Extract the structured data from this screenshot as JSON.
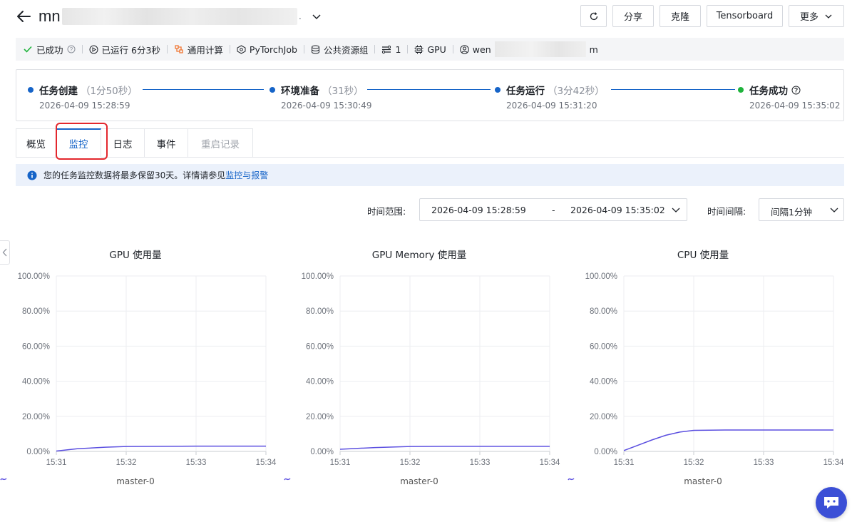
{
  "header": {
    "title_visible": "mn",
    "title_suffix_visible": ".",
    "buttons": {
      "refresh_icon": "refresh-icon",
      "share": "分享",
      "clone": "克隆",
      "tensorboard": "Tensorboard",
      "more": "更多"
    }
  },
  "meta": {
    "status": "已成功",
    "runtime": "已运行 6分3秒",
    "compute_type": "通用计算",
    "framework": "PyTorchJob",
    "resource_group": "公共资源组",
    "replicas": "1",
    "device": "GPU",
    "user_prefix": "wen",
    "user_suffix": "m"
  },
  "timeline": [
    {
      "title": "任务创建",
      "duration": "（1分50秒）",
      "time": "2026-04-09 15:28:59",
      "color": "#1664c8"
    },
    {
      "title": "环境准备",
      "duration": "（31秒）",
      "time": "2026-04-09 15:30:49",
      "color": "#1664c8"
    },
    {
      "title": "任务运行",
      "duration": "（3分42秒）",
      "time": "2026-04-09 15:31:20",
      "color": "#1664c8"
    },
    {
      "title": "任务成功",
      "duration": "",
      "time": "2026-04-09 15:35:02",
      "color": "#1fb33c"
    }
  ],
  "tabs": [
    "概览",
    "监控",
    "日志",
    "事件",
    "重启记录"
  ],
  "banner": {
    "text": "您的任务监控数据将最多保留30天。详情请参见",
    "link": "监控与报警"
  },
  "filters": {
    "range_label": "时间范围:",
    "range_start": "2026-04-09 15:28:59",
    "range_sep": "-",
    "range_end": "2026-04-09 15:35:02",
    "interval_label": "时间间隔:",
    "interval_value": "间隔1分钟"
  },
  "accent_color": "#1664c8",
  "chart_data": [
    {
      "type": "line",
      "title": "GPU 使用量",
      "x": [
        "15:31",
        "15:32",
        "15:33",
        "15:34"
      ],
      "yticks": [
        "0.00%",
        "20.00%",
        "40.00%",
        "60.00%",
        "80.00%",
        "100.00%"
      ],
      "ylim": [
        0,
        100
      ],
      "series": [
        {
          "name": "master-0",
          "points": [
            [
              0,
              0.2
            ],
            [
              0.3,
              1.5
            ],
            [
              0.7,
              2.4
            ],
            [
              1,
              2.8
            ],
            [
              1.5,
              2.9
            ],
            [
              2,
              3.0
            ],
            [
              2.5,
              3.0
            ],
            [
              3,
              3.0
            ]
          ]
        }
      ]
    },
    {
      "type": "line",
      "title": "GPU Memory 使用量",
      "x": [
        "15:31",
        "15:32",
        "15:33",
        "15:34"
      ],
      "yticks": [
        "0.00%",
        "20.00%",
        "40.00%",
        "60.00%",
        "80.00%",
        "100.00%"
      ],
      "ylim": [
        0,
        100
      ],
      "series": [
        {
          "name": "master-0",
          "points": [
            [
              0,
              1.2
            ],
            [
              0.5,
              2.2
            ],
            [
              1,
              2.8
            ],
            [
              1.5,
              2.9
            ],
            [
              2,
              2.9
            ],
            [
              2.5,
              2.9
            ],
            [
              3,
              2.9
            ]
          ]
        }
      ]
    },
    {
      "type": "line",
      "title": "CPU 使用量",
      "x": [
        "15:31",
        "15:32",
        "15:33",
        "15:34"
      ],
      "yticks": [
        "0.00%",
        "20.00%",
        "40.00%",
        "60.00%",
        "80.00%",
        "100.00%"
      ],
      "ylim": [
        0,
        100
      ],
      "series": [
        {
          "name": "master-0",
          "points": [
            [
              0,
              0.5
            ],
            [
              0.2,
              3.5
            ],
            [
              0.4,
              6.5
            ],
            [
              0.6,
              9.2
            ],
            [
              0.8,
              11.0
            ],
            [
              1,
              12.0
            ],
            [
              1.5,
              12.2
            ],
            [
              2,
              12.2
            ],
            [
              2.5,
              12.2
            ],
            [
              3,
              12.2
            ]
          ]
        }
      ]
    }
  ],
  "series_color": "#5b4fe0"
}
